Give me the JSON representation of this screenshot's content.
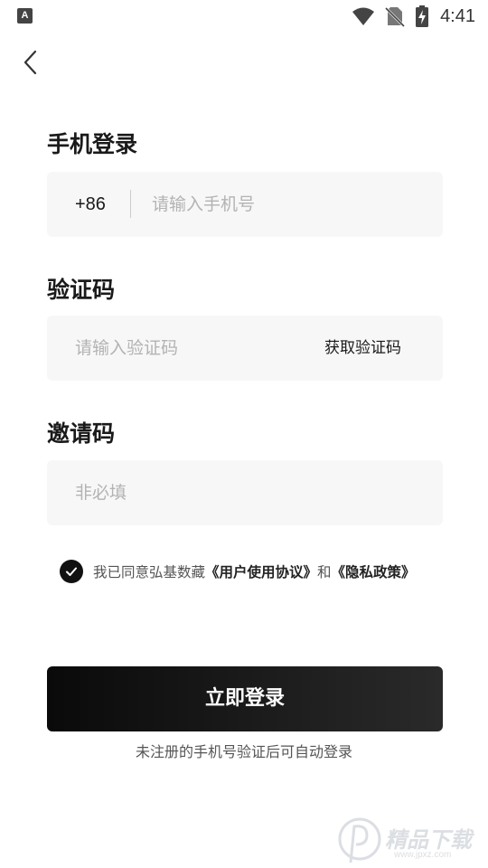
{
  "status_bar": {
    "app_icon_letter": "A",
    "time": "4:41"
  },
  "phone_login": {
    "title": "手机登录",
    "country_code": "+86",
    "phone_placeholder": "请输入手机号"
  },
  "verify": {
    "title": "验证码",
    "code_placeholder": "请输入验证码",
    "get_code_label": "获取验证码"
  },
  "invite": {
    "title": "邀请码",
    "placeholder": "非必填"
  },
  "agreement": {
    "checked": true,
    "prefix": "我已同意弘基数藏",
    "user_agreement": "《用户使用协议》",
    "and": "和",
    "privacy_policy": "《隐私政策》"
  },
  "login_button": "立即登录",
  "hint": "未注册的手机号验证后可自动登录",
  "watermark": {
    "text": "精品下载",
    "sub": "www.jpxz.com"
  }
}
